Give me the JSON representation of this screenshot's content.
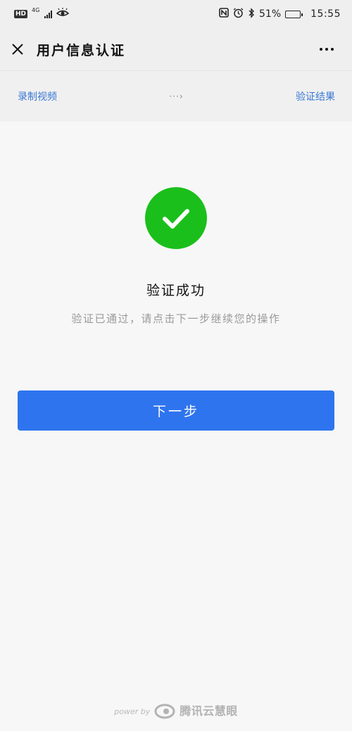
{
  "status_bar": {
    "hd": "HD",
    "network": "4G",
    "battery_percent": "51%",
    "battery_level": 0.51,
    "time": "15:55",
    "icons": [
      "hd-icon",
      "signal-icon",
      "eye-icon",
      "nfc-icon",
      "alarm-icon",
      "bluetooth-icon",
      "battery-icon"
    ]
  },
  "nav": {
    "title": "用户信息认证",
    "close_icon": "close-icon",
    "more_icon": "more-icon"
  },
  "steps": {
    "step1": "录制视频",
    "arrow": "···›",
    "step2": "验证结果"
  },
  "result": {
    "icon": "check-circle-icon",
    "icon_color": "#1bbf1b",
    "title": "验证成功",
    "description": "验证已通过，请点击下一步继续您的操作"
  },
  "actions": {
    "next_label": "下一步",
    "button_color": "#2f74ef"
  },
  "footer": {
    "powered_by": "power by",
    "brand": "腾讯云慧眼"
  }
}
